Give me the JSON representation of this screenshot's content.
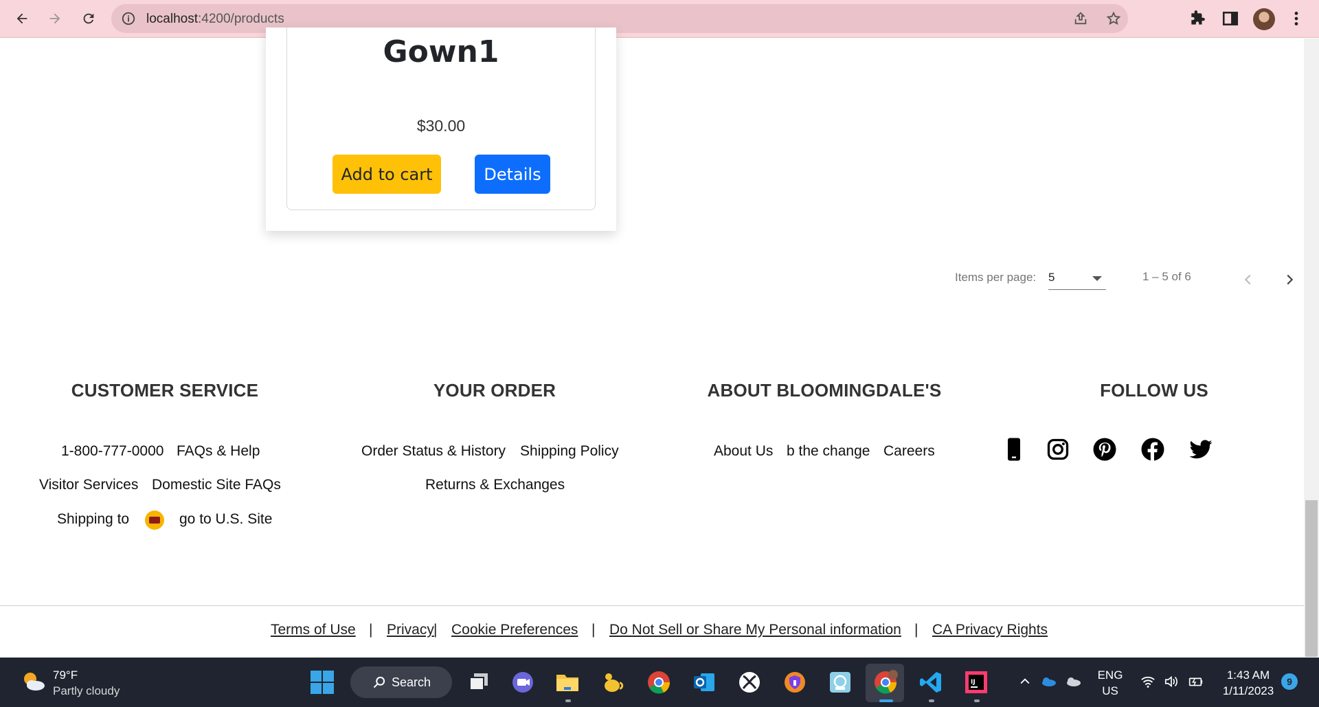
{
  "browser": {
    "url_host": "localhost",
    "url_path": ":4200/products"
  },
  "product": {
    "title": "Gown1",
    "price": "$30.00",
    "add_to_cart_label": "Add to cart",
    "details_label": "Details"
  },
  "paginator": {
    "items_per_page_label": "Items per page:",
    "items_per_page_value": "5",
    "range_label": "1 – 5 of 6"
  },
  "footer": {
    "customer_service": {
      "heading": "CUSTOMER SERVICE",
      "phone": "1-800-777-0000",
      "faqs_help": "FAQs & Help",
      "visitor_services": "Visitor Services",
      "domestic_faqs": "Domestic Site FAQs",
      "shipping_to": "Shipping to",
      "go_to_us": "go to U.S. Site"
    },
    "your_order": {
      "heading": "YOUR ORDER",
      "order_status": "Order Status & History",
      "shipping_policy": "Shipping Policy",
      "returns": "Returns & Exchanges"
    },
    "about": {
      "heading": "ABOUT BLOOMINGDALE'S",
      "about_us": "About Us",
      "b_the_change": "b the change",
      "careers": "Careers"
    },
    "follow": {
      "heading": "FOLLOW US",
      "icons": [
        "phone-icon",
        "instagram-icon",
        "pinterest-icon",
        "facebook-icon",
        "twitter-icon"
      ]
    },
    "legal": {
      "terms": "Terms of Use",
      "privacy": "Privacy",
      "cookie": "Cookie Preferences",
      "do_not_sell": "Do Not Sell or Share My Personal information",
      "ca_privacy": "CA Privacy Rights",
      "separator": "|"
    }
  },
  "taskbar": {
    "weather_temp": "79°F",
    "weather_desc": "Partly cloudy",
    "search_label": "Search",
    "lang_line1": "ENG",
    "lang_line2": "US",
    "time": "1:43 AM",
    "date": "1/11/2023",
    "notification_count": "9"
  },
  "colors": {
    "browser_bar": "#f8d6dc",
    "add_to_cart": "#ffc107",
    "details": "#0d6efd",
    "taskbar": "#1f2430"
  }
}
